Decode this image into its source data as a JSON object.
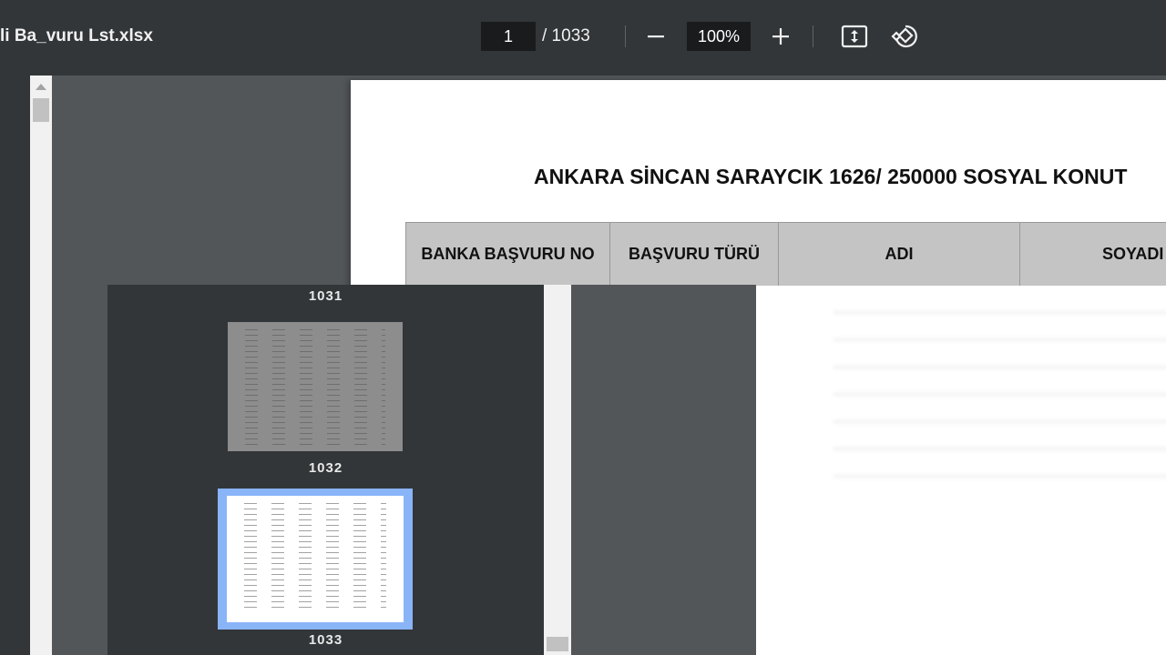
{
  "toolbar": {
    "title": "li Ba_vuru Lst.xlsx",
    "page_current": "1",
    "page_total": "/ 1033",
    "zoom": "100%",
    "icons": [
      "minus-icon",
      "plus-icon",
      "fit-page-icon",
      "rotate-icon"
    ]
  },
  "document": {
    "heading": "ANKARA SİNCAN SARAYCIK 1626/ 250000 SOSYAL KONUT",
    "columns": [
      "BANKA BAŞVURU NO",
      "BAŞVURU TÜRÜ",
      "ADI",
      "SOYADI"
    ]
  },
  "thumbnails": {
    "items": [
      {
        "page": "1031"
      },
      {
        "page": "1032"
      },
      {
        "page": "1033"
      }
    ],
    "selected": "1033"
  },
  "colors": {
    "toolbar_bg": "#323639",
    "viewer_bg": "#525659",
    "header_row_bg": "#c4c4c4",
    "selection": "#8ab4f8"
  }
}
